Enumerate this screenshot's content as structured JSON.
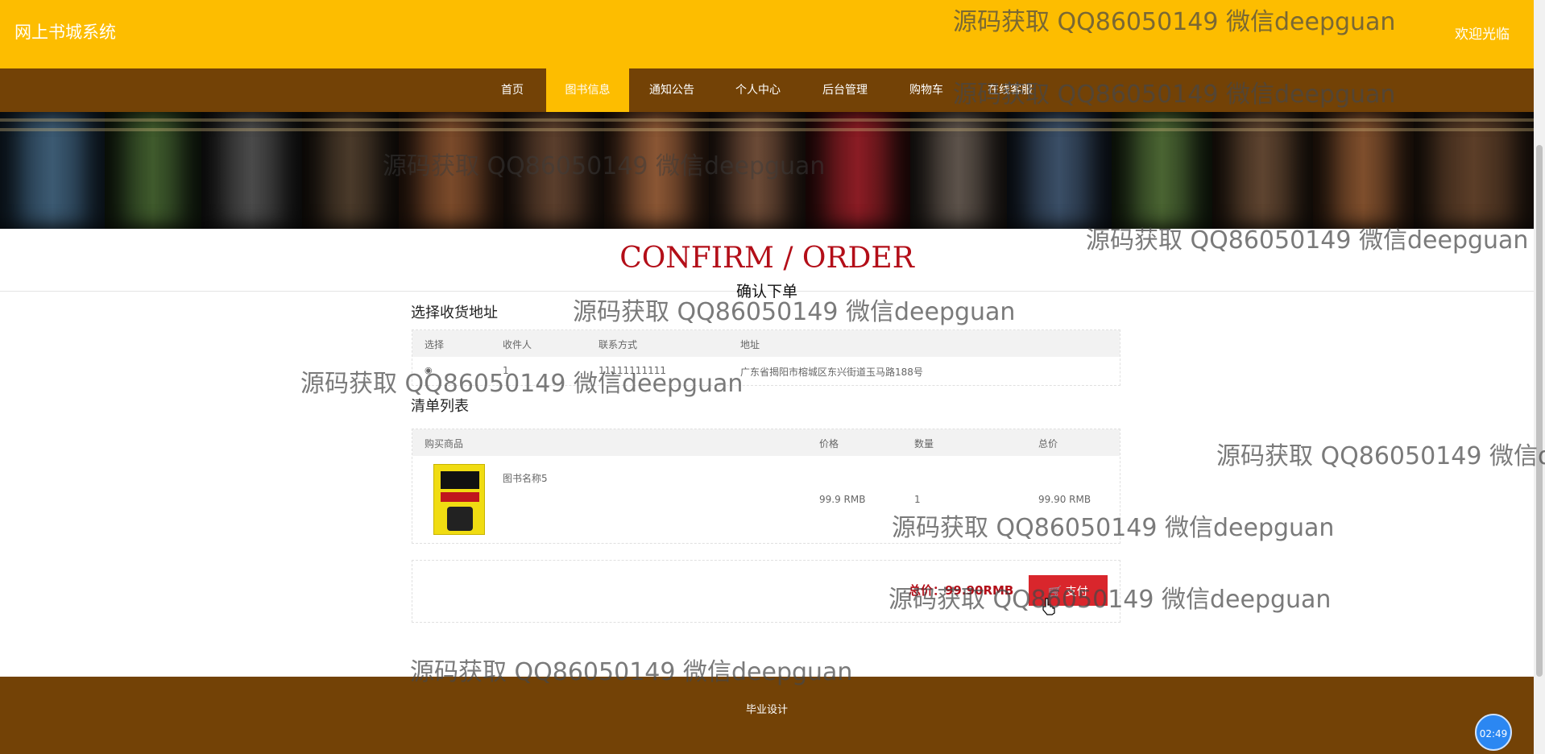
{
  "header": {
    "brand": "网上书城系统",
    "welcome": "欢迎光临"
  },
  "nav": {
    "items": [
      {
        "label": "首页"
      },
      {
        "label": "图书信息"
      },
      {
        "label": "通知公告"
      },
      {
        "label": "个人中心"
      },
      {
        "label": "后台管理"
      },
      {
        "label": "购物车"
      },
      {
        "label": "在线客服"
      }
    ],
    "active_item": "图书信息"
  },
  "page": {
    "title_en": "CONFIRM / ORDER",
    "title_cn": "确认下单"
  },
  "address": {
    "label": "选择收货地址",
    "headers": [
      "选择",
      "收件人",
      "联系方式",
      "地址"
    ],
    "rows": [
      {
        "selected": "◉",
        "recipient": "1",
        "phone": "11111111111",
        "address": "广东省揭阳市榕城区东兴街道玉马路188号"
      }
    ]
  },
  "cart": {
    "label": "清单列表",
    "headers": [
      "购买商品",
      "价格",
      "数量",
      "总价"
    ],
    "items": [
      {
        "name": "图书名称5",
        "price": "99.9 RMB",
        "quantity": "1",
        "subtotal": "99.90 RMB"
      }
    ]
  },
  "checkout": {
    "total": "总价：99.90RMB",
    "pay_label": "支付",
    "cart_icon": "🛒"
  },
  "footer": {
    "text": "毕业设计"
  },
  "clock": "02:49",
  "watermark": "源码获取 QQ86050149 微信deepguan",
  "colors": {
    "header_yellow": "#fdbd00",
    "nav_brown": "#734206",
    "title_red": "#b30e18",
    "pay_red": "#d9262c"
  }
}
